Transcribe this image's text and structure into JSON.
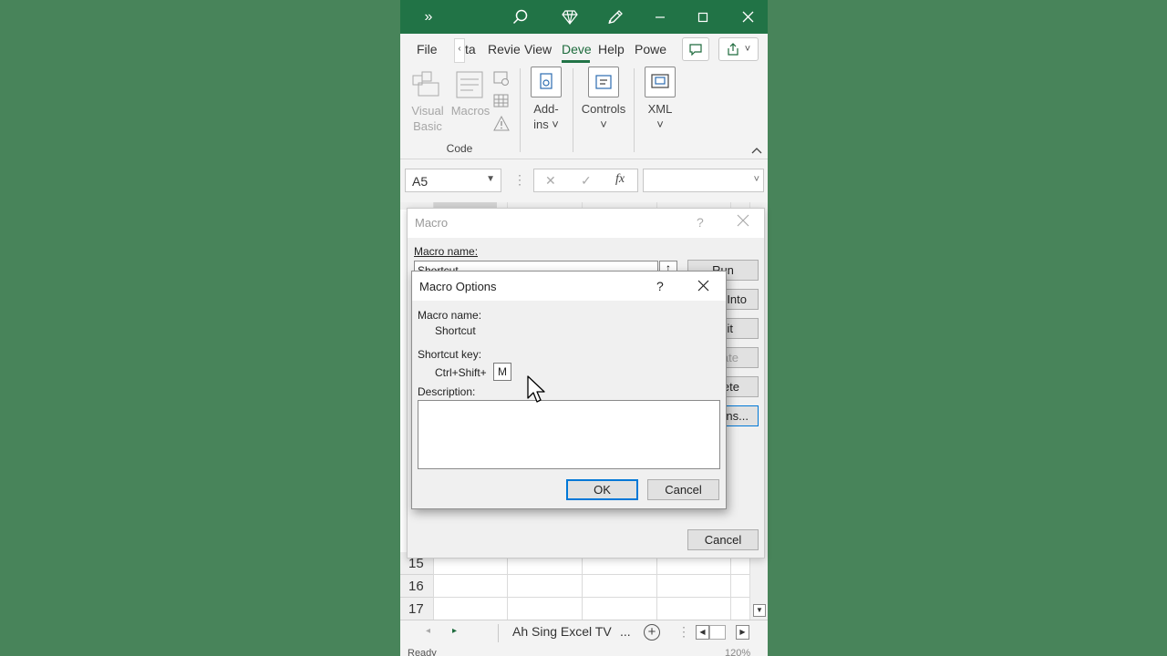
{
  "titlebar": {
    "overflow_icon": "»",
    "search_icon": "search-icon",
    "diamond_icon": "diamond-icon",
    "pen_icon": "pen-icon"
  },
  "tabs": {
    "file": "File",
    "data": "ta",
    "review": "Revie",
    "view": "View",
    "developer": "Deve",
    "help": "Help",
    "power": "Powe"
  },
  "ribbon": {
    "visual_basic": [
      "Visual",
      "Basic"
    ],
    "macros": "Macros",
    "group_code": "Code",
    "addins": [
      "Add-",
      "ins ˅"
    ],
    "controls": "Controls",
    "xml": "XML"
  },
  "formula": {
    "namebox": "A5",
    "cancel": "✕",
    "enter": "✓",
    "fx": "fx"
  },
  "grid": {
    "rows": [
      "15",
      "16",
      "17"
    ]
  },
  "sheetbar": {
    "sheet_name": "Ah Sing Excel TV",
    "more": "..."
  },
  "statusbar": {
    "ready": "Ready",
    "zoom": "120%"
  },
  "macro_dialog": {
    "title": "Macro",
    "help": "?",
    "macro_name_label": "Macro name:",
    "macro_name_value": "Shortcut",
    "buttons": {
      "run": "Run",
      "step_into": "Into",
      "edit": "it",
      "create": "ate",
      "delete": "ete",
      "options": "ns...",
      "cancel": "Cancel"
    }
  },
  "options_dialog": {
    "title": "Macro Options",
    "help": "?",
    "macro_name_label": "Macro name:",
    "macro_name_value": "Shortcut",
    "shortcut_key_label": "Shortcut key:",
    "shortcut_prefix": "Ctrl+Shift+",
    "shortcut_key_value": "M",
    "description_label": "Description:",
    "description_value": "",
    "ok": "OK",
    "cancel": "Cancel"
  }
}
